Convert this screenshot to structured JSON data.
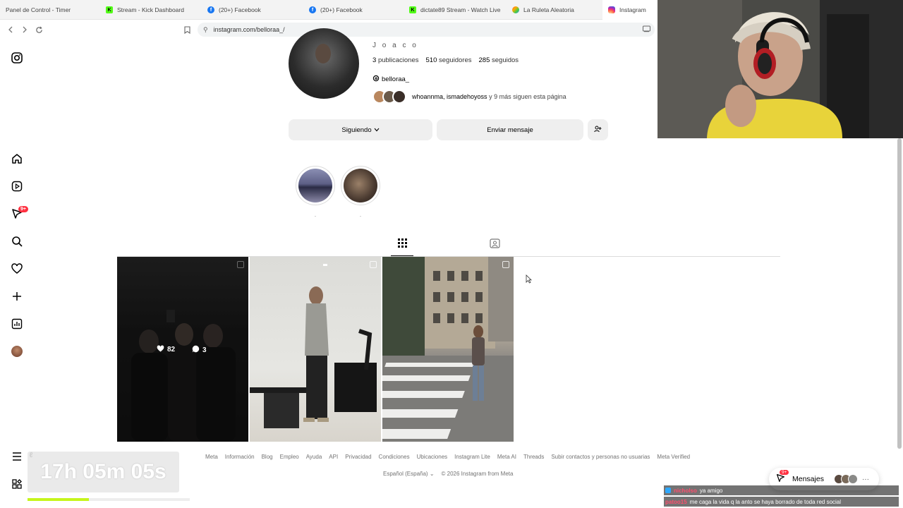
{
  "browser": {
    "tabs": [
      {
        "label": "Panel de Control - Timer",
        "icon": "timer-icon"
      },
      {
        "label": "Stream - Kick Dashboard",
        "icon": "kick-icon"
      },
      {
        "label": "(20+) Facebook",
        "icon": "facebook-icon"
      },
      {
        "label": "(20+) Facebook",
        "icon": "facebook-icon"
      },
      {
        "label": "dictate89 Stream - Watch Live",
        "icon": "kick-icon"
      },
      {
        "label": "La Ruleta Aleatoria",
        "icon": "roulette-icon"
      },
      {
        "label": "Instagram",
        "icon": "instagram-icon"
      }
    ],
    "url": "instagram.com/belloraa_/"
  },
  "sidebar": {
    "badge": "9+"
  },
  "profile": {
    "username": "J o a c o",
    "posts_count": "3",
    "posts_label": "publicaciones",
    "followers_count": "510",
    "followers_label": "seguidores",
    "following_count": "285",
    "following_label": "seguidos",
    "threads_handle": "belloraa_",
    "followed_by_names": "whoannma, ismadehoyoss",
    "followed_by_rest": "y 9 más siguen esta página",
    "following_button": "Siguiendo",
    "message_button": "Enviar mensaje"
  },
  "highlights": [
    {
      "label": "."
    },
    {
      "label": "."
    }
  ],
  "posts": [
    {
      "likes": "82",
      "comments": "3"
    }
  ],
  "footer": {
    "links": [
      "Meta",
      "Información",
      "Blog",
      "Empleo",
      "Ayuda",
      "API",
      "Privacidad",
      "Condiciones",
      "Ubicaciones",
      "Instagram Lite",
      "Meta AI",
      "Threads",
      "Subir contactos y personas no usuarias",
      "Meta Verified"
    ],
    "language": "Español (España)",
    "copyright": "© 2026 Instagram from Meta"
  },
  "overlay": {
    "timer": "17h 05m 05s",
    "progress": 0.38
  },
  "messages": {
    "label": "Mensajes",
    "badge": "9+"
  },
  "chat": [
    {
      "name": "nicholso",
      "text": "ya amigo"
    },
    {
      "name": "patoo15",
      "text": "me caga la vida q la anto se haya borrado de toda red social"
    }
  ],
  "colors": {
    "instagram_badge": "#ff3040",
    "progress_fill": "#c6f51a",
    "kick_green": "#53fc18",
    "facebook_blue": "#1877f2"
  }
}
